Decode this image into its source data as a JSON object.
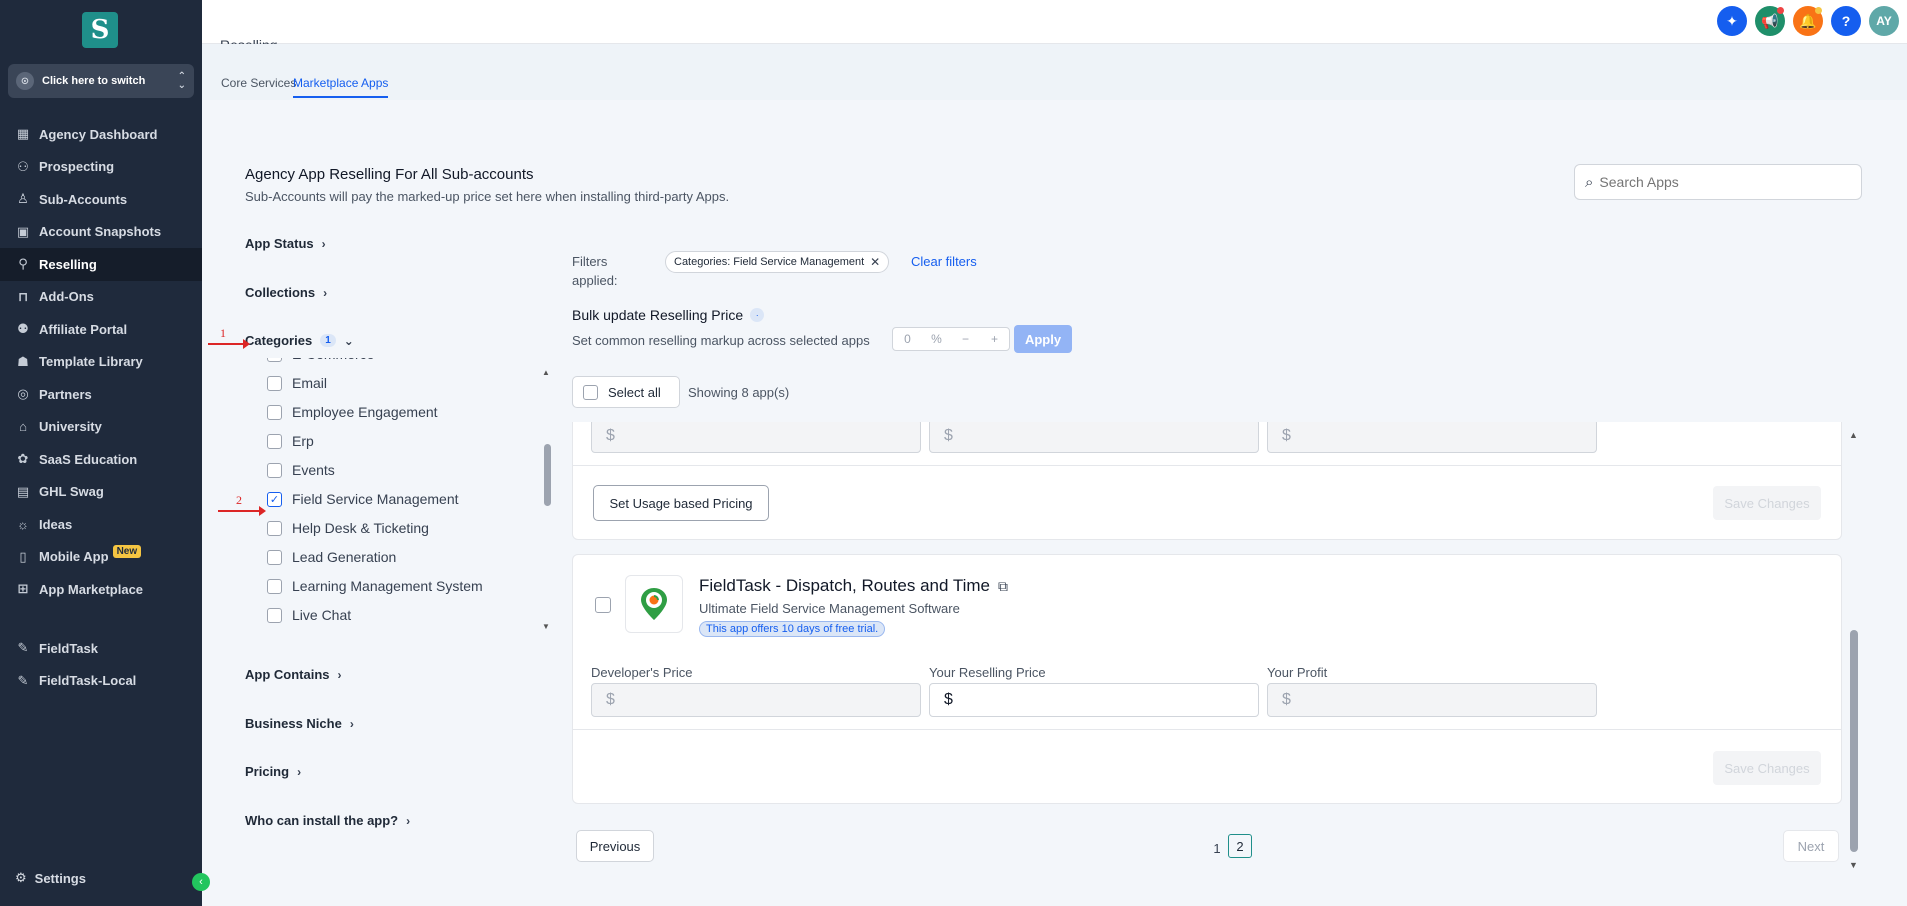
{
  "sidebar": {
    "logo_letter": "S",
    "switcher_label": "Click here to switch",
    "items": [
      {
        "label": "Agency Dashboard",
        "icon": "dashboard-icon",
        "glyph": "▦"
      },
      {
        "label": "Prospecting",
        "icon": "prospecting-icon",
        "glyph": "⚇"
      },
      {
        "label": "Sub-Accounts",
        "icon": "user-icon",
        "glyph": "♙"
      },
      {
        "label": "Account Snapshots",
        "icon": "snapshot-icon",
        "glyph": "▣"
      },
      {
        "label": "Reselling",
        "icon": "reselling-icon",
        "glyph": "⚲",
        "active": true
      },
      {
        "label": "Add-Ons",
        "icon": "bag-icon",
        "glyph": "⊓"
      },
      {
        "label": "Affiliate Portal",
        "icon": "users-icon",
        "glyph": "⚉"
      },
      {
        "label": "Template Library",
        "icon": "library-icon",
        "glyph": "☗"
      },
      {
        "label": "Partners",
        "icon": "handshake-icon",
        "glyph": "◎"
      },
      {
        "label": "University",
        "icon": "graduation-cap-icon",
        "glyph": "⌂"
      },
      {
        "label": "SaaS Education",
        "icon": "education-icon",
        "glyph": "✿"
      },
      {
        "label": "GHL Swag",
        "icon": "store-icon",
        "glyph": "▤"
      },
      {
        "label": "Ideas",
        "icon": "lightbulb-icon",
        "glyph": "☼"
      },
      {
        "label": "Mobile App",
        "icon": "mobile-icon",
        "glyph": "▯",
        "badge": "New"
      },
      {
        "label": "App Marketplace",
        "icon": "grid-icon",
        "glyph": "⊞"
      }
    ],
    "items2": [
      {
        "label": "FieldTask",
        "icon": "wrench-icon",
        "glyph": "✎"
      },
      {
        "label": "FieldTask-Local",
        "icon": "wrench-icon",
        "glyph": "✎"
      }
    ],
    "settings_label": "Settings",
    "collapse_glyph": "‹"
  },
  "header": {
    "page_title": "Reselling",
    "avatar_initials": "AY",
    "icon_colors": [
      "#155eef",
      "#1f8f6a",
      "#f97316",
      "#155eef",
      "#5fa8a8"
    ]
  },
  "tabs": [
    {
      "label": "Core Services"
    },
    {
      "label": "Marketplace Apps",
      "active": true
    }
  ],
  "main": {
    "title": "Agency App Reselling For All Sub-accounts",
    "subtitle": "Sub-Accounts will pay the marked-up price set here when installing third-party Apps.",
    "search_placeholder": "Search Apps"
  },
  "filters": {
    "app_status": "App Status",
    "collections": "Collections",
    "categories": "Categories",
    "categories_count": "1",
    "category_items": [
      {
        "label": "E-Commerce",
        "checked": false
      },
      {
        "label": "Email",
        "checked": false
      },
      {
        "label": "Employee Engagement",
        "checked": false
      },
      {
        "label": "Erp",
        "checked": false
      },
      {
        "label": "Events",
        "checked": false
      },
      {
        "label": "Field Service Management",
        "checked": true
      },
      {
        "label": "Help Desk & Ticketing",
        "checked": false
      },
      {
        "label": "Lead Generation",
        "checked": false
      },
      {
        "label": "Learning Management System",
        "checked": false
      },
      {
        "label": "Live Chat",
        "checked": false
      }
    ],
    "app_contains": "App Contains",
    "business_niche": "Business Niche",
    "pricing": "Pricing",
    "who_can_install": "Who can install the app?"
  },
  "annotations": {
    "step1": "1",
    "step2": "2"
  },
  "applied": {
    "label": "Filters applied:",
    "chip": "Categories: Field Service Management",
    "clear": "Clear filters"
  },
  "bulk": {
    "title": "Bulk update Reselling Price",
    "desc": "Set common reselling markup across selected apps",
    "value": "0",
    "unit": "%",
    "minus": "−",
    "plus": "+",
    "apply": "Apply"
  },
  "list": {
    "select_all": "Select all",
    "showing": "Showing 8 app(s)",
    "prev_card": {
      "currency": "$",
      "usage_button": "Set Usage based Pricing",
      "save": "Save Changes"
    },
    "app": {
      "name": "FieldTask - Dispatch, Routes and Time",
      "subtitle": "Ultimate Field Service Management Software",
      "trial": "This app offers 10 days of free trial.",
      "developer_price_label": "Developer's Price",
      "reselling_price_label": "Your Reselling Price",
      "profit_label": "Your Profit",
      "currency": "$",
      "save": "Save Changes"
    }
  },
  "pagination": {
    "prev": "Previous",
    "pages": [
      "1",
      "2"
    ],
    "current": "2",
    "next": "Next"
  }
}
